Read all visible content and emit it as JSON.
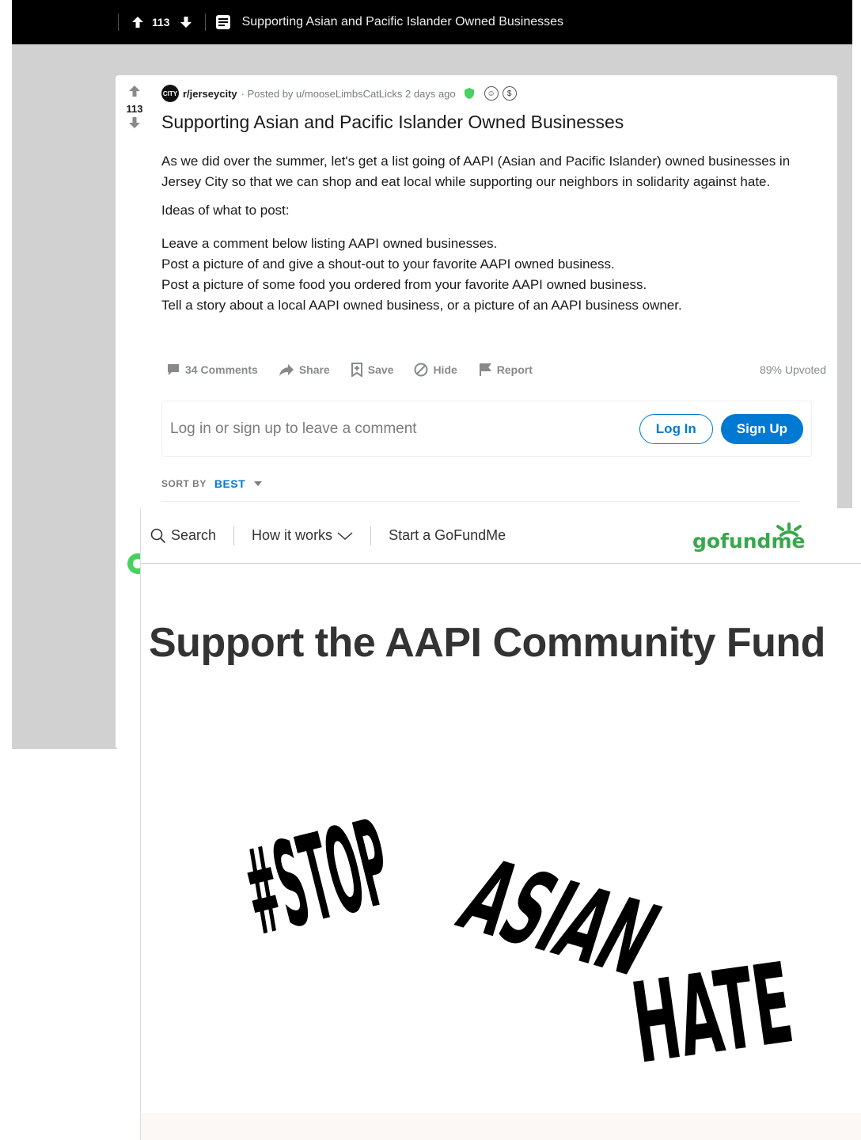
{
  "reddit": {
    "topbar": {
      "votes": "113",
      "title": "Supporting Asian and Pacific Islander Owned Businesses"
    },
    "post": {
      "votes": "113",
      "subreddit_avatar_text": "CITY",
      "subreddit": "r/jerseycity",
      "posted_by": "· Posted by u/mooseLimbsCatLicks 2 days ago",
      "title": "Supporting Asian and Pacific Islander Owned Businesses",
      "paragraph1": "As we did over the summer, let's get a list going of AAPI (Asian and Pacific Islander) owned businesses in Jersey City so that we can shop and eat local while supporting our neighbors in solidarity against hate.",
      "paragraph2": "Ideas of what to post:",
      "ideas": [
        "Leave a comment below listing AAPI owned businesses.",
        "Post a picture of and give a shout-out to your favorite AAPI owned business.",
        "Post a picture of some food you ordered from your favorite AAPI owned business.",
        "Tell a story about a local AAPI owned business, or a picture of an AAPI business owner."
      ],
      "actions": {
        "comments": "34 Comments",
        "share": "Share",
        "save": "Save",
        "hide": "Hide",
        "report": "Report",
        "upvoted": "89% Upvoted"
      }
    },
    "comment_box": {
      "prompt": "Log in or sign up to leave a comment",
      "login": "Log In",
      "signup": "Sign Up"
    },
    "sort": {
      "label": "SORT BY",
      "value": "BEST"
    },
    "colors": {
      "accent": "#0079d3",
      "mod_badge": "#46d160"
    }
  },
  "gofundme": {
    "nav": {
      "search": "Search",
      "how_it_works": "How it works",
      "start": "Start a GoFundMe"
    },
    "logo_text": "gofundme",
    "heading": "Support the AAPI Community Fund",
    "image_text": {
      "line1": "#STOP",
      "line2": "ASIAN",
      "line3": "HATE"
    },
    "colors": {
      "brand": "#36a84b"
    }
  }
}
